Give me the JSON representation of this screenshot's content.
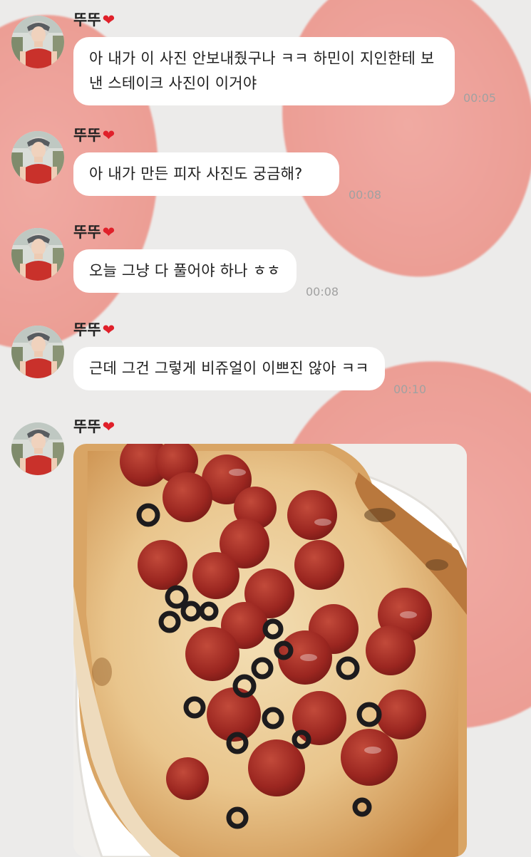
{
  "chat": {
    "messages": [
      {
        "sender": "뚜뚜",
        "text": "아 내가 이 사진 안보내줬구나 ㅋㅋ 하민이 지인한테 보낸 스테이크 사진이 이거야",
        "time": "00:05"
      },
      {
        "sender": "뚜뚜",
        "text": "아 내가 만든 피자 사진도 궁금해?",
        "time": "00:08"
      },
      {
        "sender": "뚜뚜",
        "text": "오늘 그냥 다 풀어야 하나 ㅎㅎ",
        "time": "00:08"
      },
      {
        "sender": "뚜뚜",
        "text": "근데 그건 그렇게 비쥬얼이 이쁘진 않아 ㅋㅋ",
        "time": "00:10"
      },
      {
        "sender": "뚜뚜"
      }
    ],
    "heart": "❤",
    "icons": [
      "avatar-icon",
      "heart-icon"
    ],
    "colors": {
      "background": "#ecebea",
      "blob": "#ee9d94",
      "bubble": "#ffffff",
      "heart": "#e0202a",
      "timestamp": "#a1a1a1"
    }
  }
}
